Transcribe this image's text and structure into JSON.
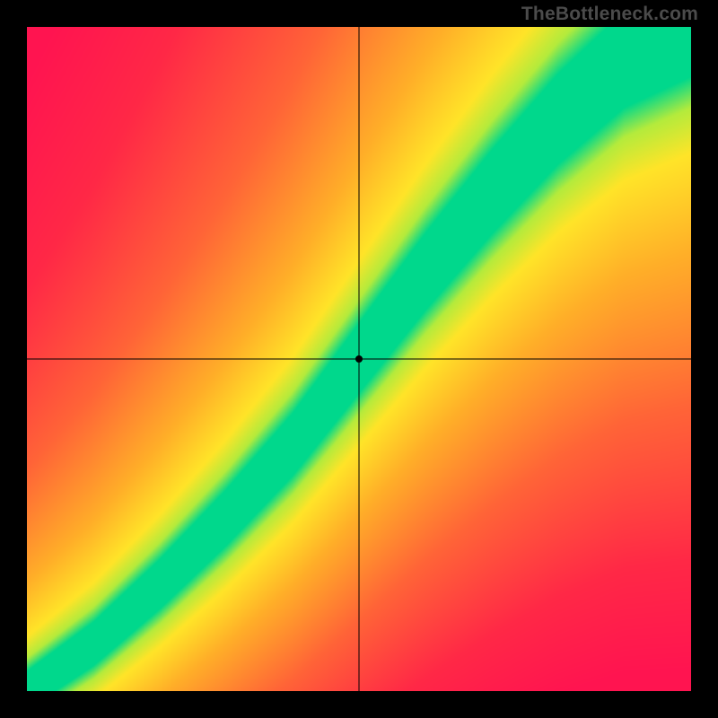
{
  "watermark": "TheBottleneck.com",
  "chart_data": {
    "type": "heatmap",
    "title": "",
    "xlabel": "",
    "ylabel": "",
    "xlim": [
      0,
      1
    ],
    "ylim": [
      0,
      1
    ],
    "grid": false,
    "crosshair": {
      "x": 0.5,
      "y": 0.5
    },
    "marker": {
      "x": 0.5,
      "y": 0.5
    },
    "colorscale_note": "value 0 = red, 0.5 = yellow/green, 1 = green (optimal match)",
    "optimal_band": {
      "description": "Narrow green S-shaped band of optimal CPU/GPU pairing from bottom-left to top-right",
      "points": [
        {
          "x": 0.0,
          "y": 0.0
        },
        {
          "x": 0.1,
          "y": 0.07
        },
        {
          "x": 0.2,
          "y": 0.16
        },
        {
          "x": 0.3,
          "y": 0.26
        },
        {
          "x": 0.4,
          "y": 0.37
        },
        {
          "x": 0.5,
          "y": 0.5
        },
        {
          "x": 0.6,
          "y": 0.63
        },
        {
          "x": 0.7,
          "y": 0.75
        },
        {
          "x": 0.8,
          "y": 0.86
        },
        {
          "x": 0.9,
          "y": 0.95
        },
        {
          "x": 1.0,
          "y": 1.0
        }
      ],
      "band_half_width": 0.055
    },
    "field": {
      "description": "score = 1 - clamped distance to optimal band; rendered red->orange->yellow->green",
      "sample_values": [
        {
          "x": 0.05,
          "y": 0.95,
          "value": 0.02
        },
        {
          "x": 0.95,
          "y": 0.05,
          "value": 0.02
        },
        {
          "x": 0.5,
          "y": 0.5,
          "value": 1.0
        },
        {
          "x": 0.8,
          "y": 0.85,
          "value": 0.98
        },
        {
          "x": 0.2,
          "y": 0.17,
          "value": 0.98
        },
        {
          "x": 0.9,
          "y": 0.55,
          "value": 0.35
        },
        {
          "x": 0.55,
          "y": 0.9,
          "value": 0.35
        }
      ]
    }
  }
}
